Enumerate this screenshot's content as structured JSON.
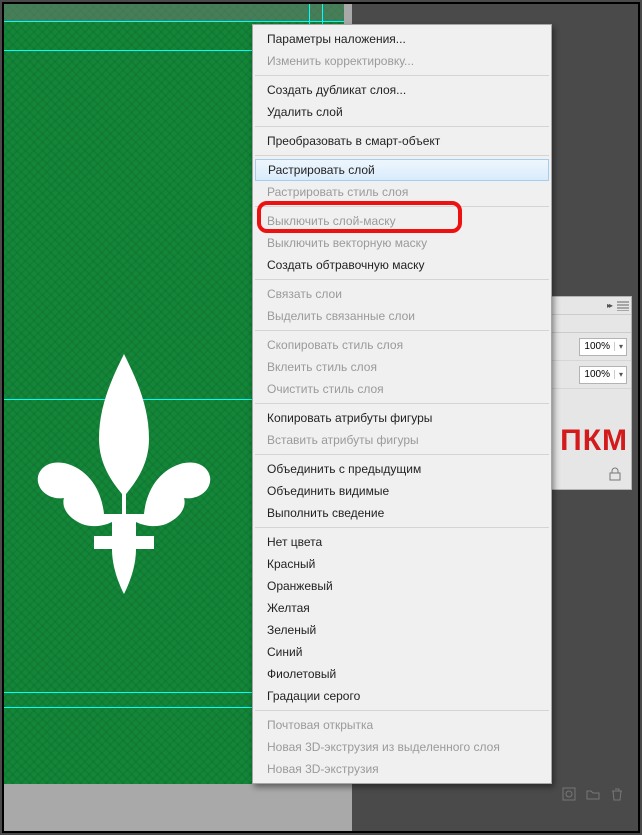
{
  "annotation": {
    "label": "ПКМ"
  },
  "panel": {
    "pct1": "100%",
    "pct2": "100%"
  },
  "menu": {
    "groups": [
      [
        {
          "label": "Параметры наложения...",
          "disabled": false
        },
        {
          "label": "Изменить корректировку...",
          "disabled": true
        }
      ],
      [
        {
          "label": "Создать дубликат слоя...",
          "disabled": false
        },
        {
          "label": "Удалить слой",
          "disabled": false
        }
      ],
      [
        {
          "label": "Преобразовать в смарт-объект",
          "disabled": false
        }
      ],
      [
        {
          "label": "Растрировать слой",
          "disabled": false,
          "highlight": true
        },
        {
          "label": "Растрировать стиль слоя",
          "disabled": true
        }
      ],
      [
        {
          "label": "Выключить слой-маску",
          "disabled": true
        },
        {
          "label": "Выключить векторную маску",
          "disabled": true
        },
        {
          "label": "Создать обтравочную маску",
          "disabled": false
        }
      ],
      [
        {
          "label": "Связать слои",
          "disabled": true
        },
        {
          "label": "Выделить связанные слои",
          "disabled": true
        }
      ],
      [
        {
          "label": "Скопировать стиль слоя",
          "disabled": true
        },
        {
          "label": "Вклеить стиль слоя",
          "disabled": true
        },
        {
          "label": "Очистить стиль слоя",
          "disabled": true
        }
      ],
      [
        {
          "label": "Копировать атрибуты фигуры",
          "disabled": false
        },
        {
          "label": "Вставить атрибуты фигуры",
          "disabled": true
        }
      ],
      [
        {
          "label": "Объединить с предыдущим",
          "disabled": false
        },
        {
          "label": "Объединить видимые",
          "disabled": false
        },
        {
          "label": "Выполнить сведение",
          "disabled": false
        }
      ],
      [
        {
          "label": "Нет цвета",
          "disabled": false
        },
        {
          "label": "Красный",
          "disabled": false
        },
        {
          "label": "Оранжевый",
          "disabled": false
        },
        {
          "label": "Желтая",
          "disabled": false
        },
        {
          "label": "Зеленый",
          "disabled": false
        },
        {
          "label": "Синий",
          "disabled": false
        },
        {
          "label": "Фиолетовый",
          "disabled": false
        },
        {
          "label": "Градации серого",
          "disabled": false
        }
      ],
      [
        {
          "label": "Почтовая открытка",
          "disabled": true
        },
        {
          "label": "Новая 3D-экструзия из выделенного слоя",
          "disabled": true
        },
        {
          "label": "Новая 3D-экструзия",
          "disabled": true
        }
      ]
    ]
  }
}
